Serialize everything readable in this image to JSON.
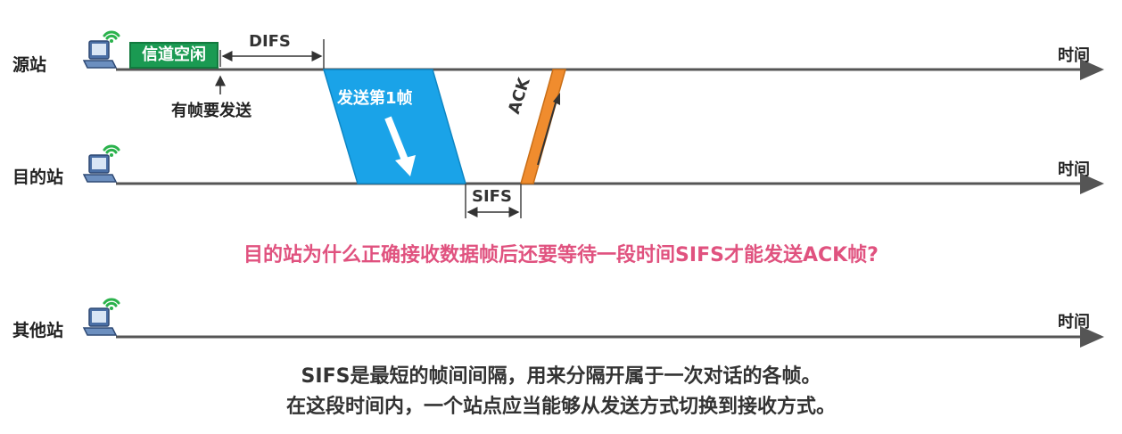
{
  "stations": {
    "source": "源站",
    "destination": "目的站",
    "other": "其他站"
  },
  "time_label": "时间",
  "labels": {
    "channel_idle": "信道空闲",
    "difs": "DIFS",
    "frame_to_send": "有帧要发送",
    "send_frame_1": "发送第1帧",
    "sifs": "SIFS",
    "ack": "ACK"
  },
  "question": "目的站为什么正确接收数据帧后还要等待一段时间SIFS才能发送ACK帧?",
  "explanation": {
    "line1": "SIFS是最短的帧间间隔，用来分隔开属于一次对话的各帧。",
    "line2": "在这段时间内，一个站点应当能够从发送方式切换到接收方式。"
  },
  "colors": {
    "data_frame": "#1aa3e8",
    "ack_frame": "#f08c2e",
    "idle_box": "#1a9a52",
    "question_text": "#e0527f",
    "wifi": "#2bb24c"
  },
  "icons": {
    "station": "laptop-wifi-icon"
  }
}
